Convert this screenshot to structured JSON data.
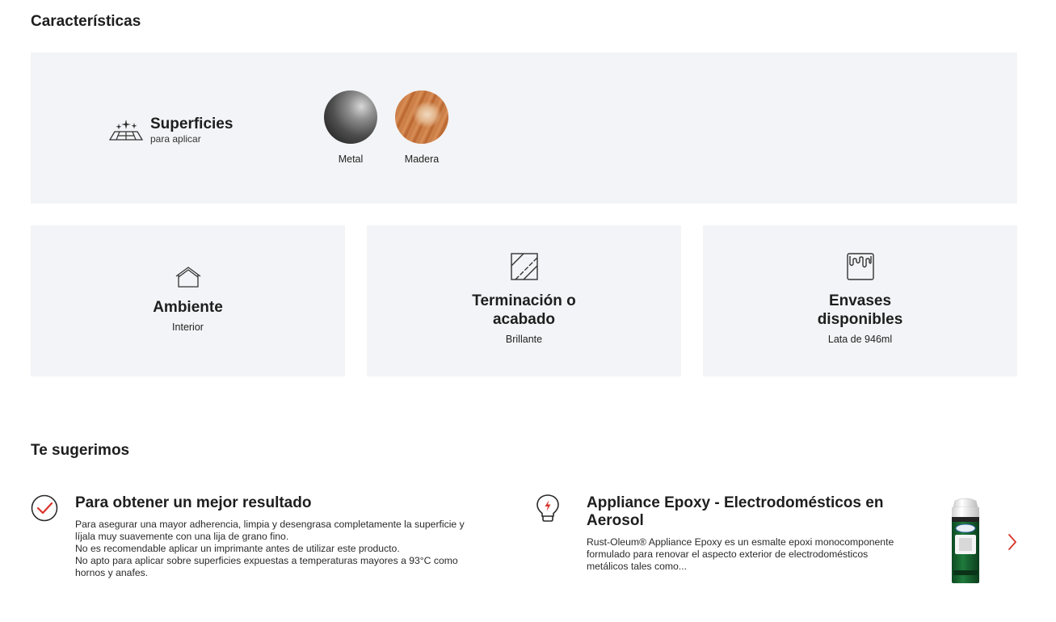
{
  "caracteristicas": {
    "title": "Características",
    "superficies": {
      "icon": "sparkle-surface-icon",
      "title": "Superficies",
      "subtitle": "para aplicar",
      "items": [
        {
          "label": "Metal"
        },
        {
          "label": "Madera"
        }
      ]
    },
    "cards": [
      {
        "icon": "house-icon",
        "title": "Ambiente",
        "value": "Interior"
      },
      {
        "icon": "gloss-finish-icon",
        "title_line1": "Terminación o",
        "title_line2": "acabado",
        "value": "Brillante"
      },
      {
        "icon": "paint-can-icon",
        "title_line1": "Envases",
        "title_line2": "disponibles",
        "value": "Lata de 946ml"
      }
    ]
  },
  "sugerimos": {
    "title": "Te sugerimos",
    "tip": {
      "icon": "check-circle-icon",
      "title": "Para obtener un mejor resultado",
      "lines": [
        "Para asegurar una mayor adherencia, limpia y desengrasa completamente la superficie y",
        "líjala muy suavemente con una lija de grano fino.",
        "No es recomendable aplicar un imprimante antes de utilizar este producto.",
        "No apto para aplicar sobre superficies expuestas a temperaturas mayores a 93°C como",
        "hornos y anafes."
      ]
    },
    "product": {
      "icon": "lightbulb-icon",
      "title_line1": "Appliance Epoxy - Electrodomésticos en",
      "title_line2": "Aerosol",
      "lines": [
        "Rust-Oleum® Appliance Epoxy es un esmalte epoxi monocomponente",
        "formulado para renovar el aspecto exterior de electrodomésticos",
        "metálicos tales como..."
      ],
      "image": "spray-can-image"
    },
    "next": "chevron-right-icon"
  },
  "colors": {
    "panel": "#f3f4f7",
    "accent": "#d9342b",
    "text": "#1e1e1e"
  }
}
